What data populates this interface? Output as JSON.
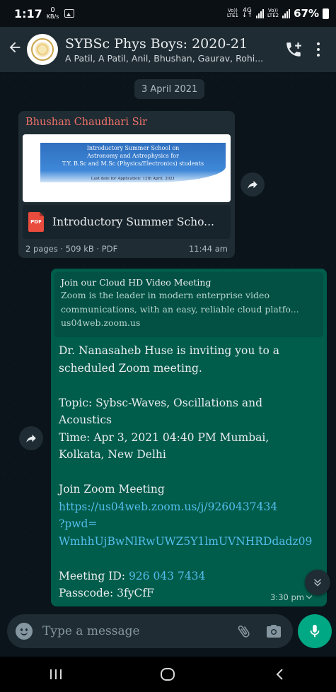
{
  "status_bar": {
    "time": "1:17",
    "kbs_value": "0",
    "kbs_unit": "KB/s",
    "net1_top": "Vo))",
    "net1_bottom": "LTE1",
    "net_type": "4G",
    "net2_top": "Vo))",
    "net2_bottom": "LTE2",
    "battery": "67%"
  },
  "header": {
    "title": "SYBSc Phys Boys: 2020-21",
    "subtitle": "A Patil, A Patil, Anil, Bhushan, Gaurav, Rohi..."
  },
  "chat": {
    "date_chip": "3 April 2021",
    "doc_message": {
      "sender": "Bhushan Chaudhari Sir",
      "preview_line1": "Introductory Summer School on",
      "preview_line2": "Astronomy and Astrophysics for",
      "preview_line3": "T.Y. B.Sc and M.Sc (Physics/Electronics) students",
      "preview_deadline": "Last date for Application: 12th April, 2021",
      "file_icon": "PDF",
      "file_name": "Introductory Summer Scho...",
      "meta": "2 pages · 509 kB · PDF",
      "time": "11:44 am"
    },
    "zoom_message": {
      "preview_title": "Join our Cloud HD Video Meeting",
      "preview_desc1": "Zoom is the leader in modern enterprise video",
      "preview_desc2": "communications, with an easy, reliable cloud platfo...",
      "preview_domain": "us04web.zoom.us",
      "lines": [
        "Dr. Nanasaheb Huse is inviting you to a",
        "scheduled Zoom meeting.",
        "",
        "Topic: Sybsc-Waves, Oscillations and",
        "Acoustics",
        "Time: Apr 3, 2021 04:40 PM Mumbai,",
        "Kolkata, New Delhi",
        "",
        "Join Zoom Meeting"
      ],
      "link_lines": [
        "https://us04web.zoom.us/j/9260437434",
        "?pwd=",
        "WmhhUjBwNlRwUWZ5Y1lmUVNHRDdadz09"
      ],
      "meeting_id_label": "Meeting ID: ",
      "meeting_id": "926 043 7434",
      "passcode": "Passcode: 3fyCfF",
      "time": "3:30 pm"
    }
  },
  "input": {
    "placeholder": "Type a message"
  },
  "colors": {
    "accent": "#00a884",
    "outgoing_bubble": "#005c4b",
    "incoming_bubble": "#1f2c33",
    "sender_name": "#f1716a",
    "link": "#53bdeb"
  }
}
